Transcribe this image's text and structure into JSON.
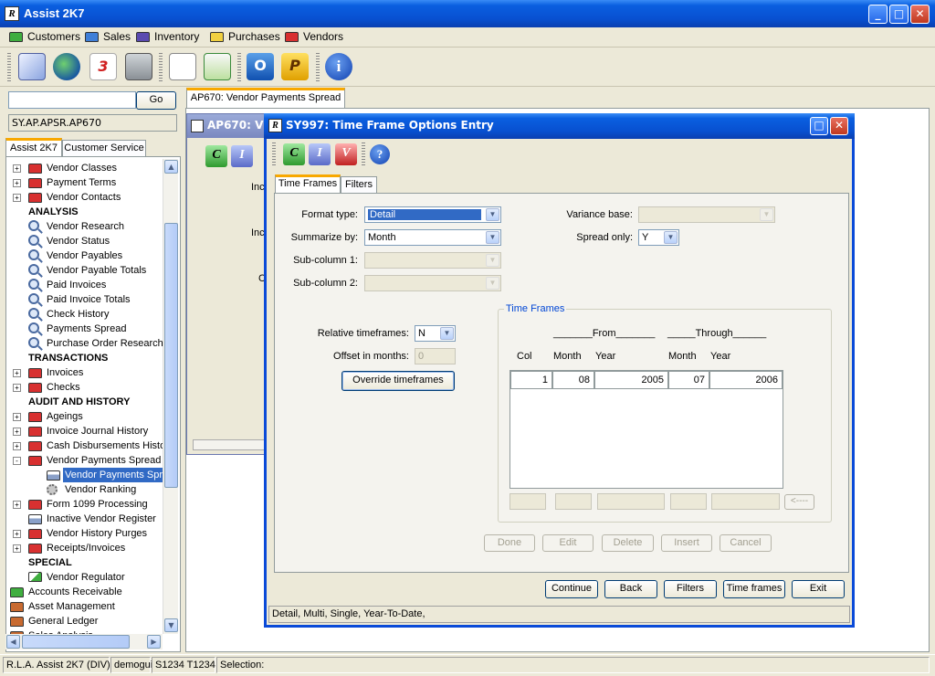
{
  "app": {
    "title": "Assist 2K7",
    "logo": "R"
  },
  "window_buttons": {
    "minimize": "_",
    "maximize": "□",
    "close": "✕"
  },
  "menu": [
    {
      "label": "Customers",
      "color": "#3fae3f"
    },
    {
      "label": "Sales",
      "color": "#3f7fd8"
    },
    {
      "label": "Inventory",
      "color": "#5a4ab0"
    },
    {
      "label": "Purchases",
      "color": "#f0d040"
    },
    {
      "label": "Vendors",
      "color": "#d83030"
    }
  ],
  "toolbar_icons": [
    "mail-icon",
    "globe-icon",
    "calendar-icon",
    "calculator-icon",
    "document-icon",
    "download-icon",
    "outlook-icon",
    "p-icon",
    "info-icon"
  ],
  "search": {
    "value": "",
    "go_label": "Go",
    "path": "SY.AP.APSR.AP670"
  },
  "left_tabs": [
    "Assist 2K7",
    "Customer Service"
  ],
  "tree": [
    {
      "label": "Vendor Classes",
      "type": "folder",
      "expand": "+"
    },
    {
      "label": "Payment Terms",
      "type": "folder",
      "expand": "+"
    },
    {
      "label": "Vendor Contacts",
      "type": "folder",
      "expand": "+"
    },
    {
      "label": "ANALYSIS",
      "type": "head"
    },
    {
      "label": "Vendor Research",
      "type": "mag"
    },
    {
      "label": "Vendor Status",
      "type": "mag"
    },
    {
      "label": "Vendor Payables",
      "type": "mag"
    },
    {
      "label": "Vendor Payable Totals",
      "type": "mag"
    },
    {
      "label": "Paid Invoices",
      "type": "mag"
    },
    {
      "label": "Paid Invoice Totals",
      "type": "mag"
    },
    {
      "label": "Check History",
      "type": "mag"
    },
    {
      "label": "Payments Spread",
      "type": "mag"
    },
    {
      "label": "Purchase Order Research",
      "type": "mag"
    },
    {
      "label": "TRANSACTIONS",
      "type": "head"
    },
    {
      "label": "Invoices",
      "type": "folder",
      "expand": "+"
    },
    {
      "label": "Checks",
      "type": "folder",
      "expand": "+"
    },
    {
      "label": "AUDIT AND HISTORY",
      "type": "head"
    },
    {
      "label": "Ageings",
      "type": "folder",
      "expand": "+"
    },
    {
      "label": "Invoice Journal History",
      "type": "folder",
      "expand": "+"
    },
    {
      "label": "Cash Disbursements History",
      "type": "folder",
      "expand": "+"
    },
    {
      "label": "Vendor Payments Spread Reports",
      "type": "folder",
      "expand": "-"
    },
    {
      "label": "Vendor Payments Spread",
      "type": "printer",
      "child": true,
      "selected": true
    },
    {
      "label": "Vendor Ranking",
      "type": "gear",
      "child": true
    },
    {
      "label": "Form 1099 Processing",
      "type": "folder",
      "expand": "+"
    },
    {
      "label": "Inactive Vendor Register",
      "type": "printer"
    },
    {
      "label": "Vendor History Purges",
      "type": "folder",
      "expand": "+"
    },
    {
      "label": "Receipts/Invoices",
      "type": "folder",
      "expand": "+"
    },
    {
      "label": "SPECIAL",
      "type": "head"
    },
    {
      "label": "Vendor Regulator",
      "type": "reg"
    },
    {
      "label": "Accounts Receivable",
      "type": "rootfolder",
      "color": "#3fae3f"
    },
    {
      "label": "Asset Management",
      "type": "rootfolder",
      "color": "#c86a30"
    },
    {
      "label": "General Ledger",
      "type": "rootfolder",
      "color": "#c86a30"
    },
    {
      "label": "Sales Analysis",
      "type": "rootfolder",
      "color": "#c86a30"
    }
  ],
  "main_tab": "AP670: Vendor Payments Spread",
  "bg_window": {
    "title": "AP670: V",
    "labels": [
      "Inc",
      "Inc",
      "C"
    ]
  },
  "dialog": {
    "title": "SY997: Time Frame Options Entry",
    "tabs": [
      "Time Frames",
      "Filters"
    ],
    "format_type": {
      "label": "Format type:",
      "value": "Detail"
    },
    "summarize_by": {
      "label": "Summarize by:",
      "value": "Month"
    },
    "sub_column_1": {
      "label": "Sub-column 1:",
      "value": ""
    },
    "sub_column_2": {
      "label": "Sub-column 2:",
      "value": ""
    },
    "variance_base": {
      "label": "Variance base:",
      "value": ""
    },
    "spread_only": {
      "label": "Spread only:",
      "value": "Y"
    },
    "relative_timeframes": {
      "label": "Relative timeframes:",
      "value": "N"
    },
    "offset_months": {
      "label": "Offset in months:",
      "value": "0"
    },
    "override_button": "Override timeframes",
    "time_frames": {
      "legend": "Time Frames",
      "from_header": "_______From_______",
      "through_header": "_____Through______",
      "columns": [
        "Col",
        "Month",
        "Year",
        "Month",
        "Year"
      ],
      "rows": [
        [
          "1",
          "08",
          "2005",
          "07",
          "2006"
        ]
      ],
      "arrow_button": "<----"
    },
    "grid_buttons": [
      "Done",
      "Edit",
      "Delete",
      "Insert",
      "Cancel"
    ],
    "bottom_buttons": [
      "Continue",
      "Back",
      "Filters",
      "Time frames",
      "Exit"
    ],
    "hint": "Detail,  Multi,  Single,  Year-To-Date,"
  },
  "status": [
    "R.L.A. Assist 2K7 (DIV)",
    "demogui",
    "S1234 T1234",
    "Selection:"
  ]
}
